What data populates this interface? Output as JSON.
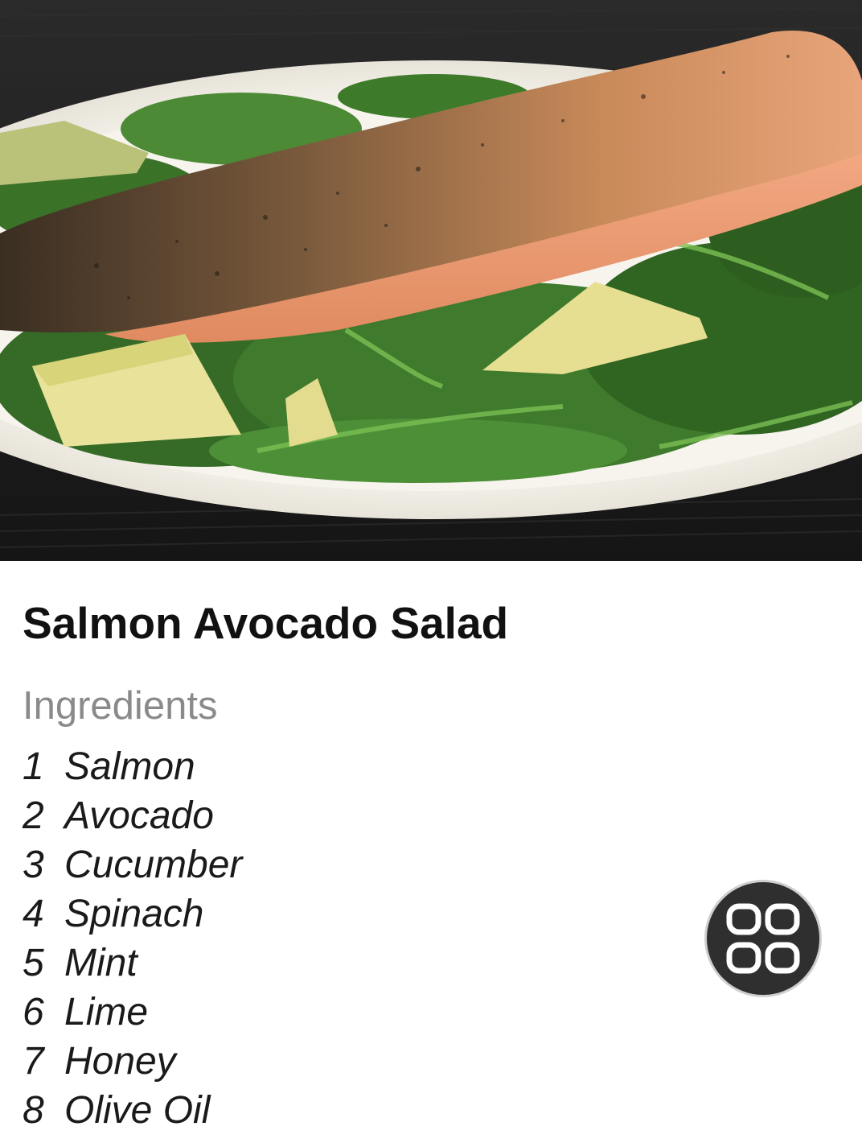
{
  "recipe": {
    "title": "Salmon Avocado Salad",
    "ingredients_heading": "Ingredients",
    "ingredients": [
      {
        "number": "1",
        "name": "Salmon"
      },
      {
        "number": "2",
        "name": "Avocado"
      },
      {
        "number": "3",
        "name": "Cucumber"
      },
      {
        "number": "4",
        "name": "Spinach"
      },
      {
        "number": "5",
        "name": "Mint"
      },
      {
        "number": "6",
        "name": "Lime"
      },
      {
        "number": "7",
        "name": "Honey"
      },
      {
        "number": "8",
        "name": "Olive Oil"
      }
    ]
  },
  "floating_action": {
    "icon": "grid-apps-icon"
  },
  "colors": {
    "title": "#111111",
    "heading": "#8a8a8a",
    "fab_background": "#2f2f2f"
  }
}
